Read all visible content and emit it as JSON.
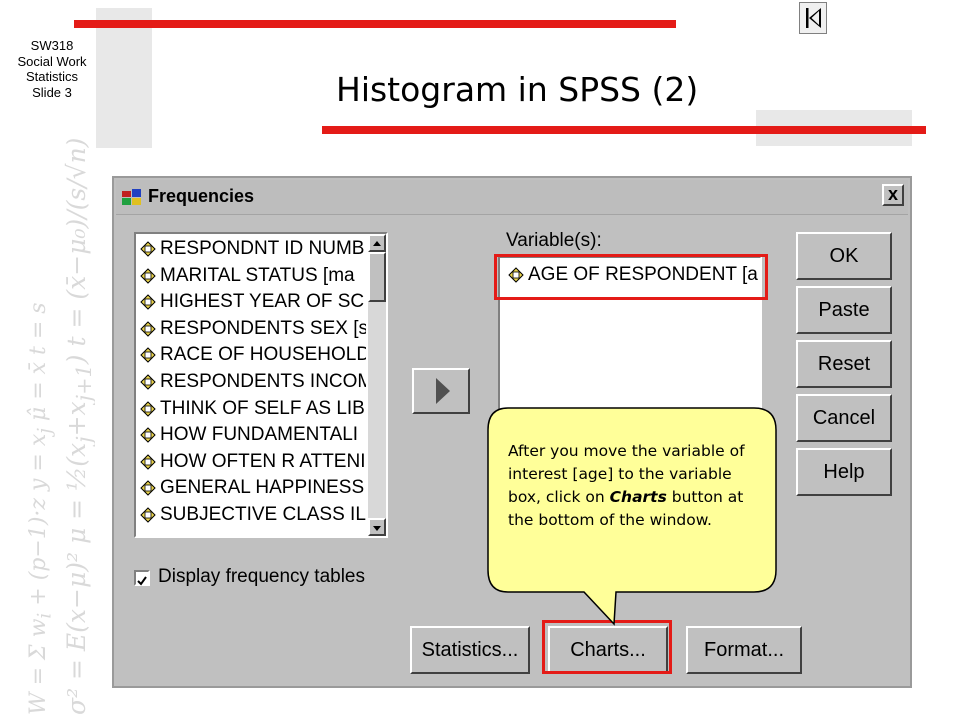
{
  "slide": {
    "course": "SW318",
    "course_name_line1": "Social Work",
    "course_name_line2": "Statistics",
    "slide_number": "Slide 3",
    "title": "Histogram in SPSS (2)",
    "nav_icon": "first-slide-icon"
  },
  "dialog": {
    "title": "Frequencies",
    "close_label": "x",
    "source_variables": [
      "RESPONDNT ID NUMB",
      "MARITAL STATUS [ma",
      "HIGHEST YEAR OF SC",
      "RESPONDENTS SEX [s",
      "RACE OF HOUSEHOLD",
      "RESPONDENTS INCOM",
      "THINK OF SELF AS LIB",
      "HOW FUNDAMENTALI",
      "HOW OFTEN R ATTENI",
      "GENERAL HAPPINESS",
      "SUBJECTIVE CLASS IL"
    ],
    "target_caption": "Variable(s):",
    "target_variables": [
      "AGE OF RESPONDENT [a"
    ],
    "buttons": {
      "ok": "OK",
      "paste": "Paste",
      "reset": "Reset",
      "cancel": "Cancel",
      "help": "Help",
      "statistics": "Statistics...",
      "charts": "Charts...",
      "format": "Format..."
    },
    "display_frequency_tables": {
      "label": "Display frequency tables",
      "checked": true
    }
  },
  "callout": {
    "text_before": "After you move the variable of interest [age] to the variable box, click on ",
    "emphasis": "Charts",
    "text_after": " button at the bottom of the window."
  },
  "colors": {
    "accent_red": "#e41b17",
    "dialog_gray": "#c0c0c0",
    "callout_fill": "#ffff99"
  }
}
